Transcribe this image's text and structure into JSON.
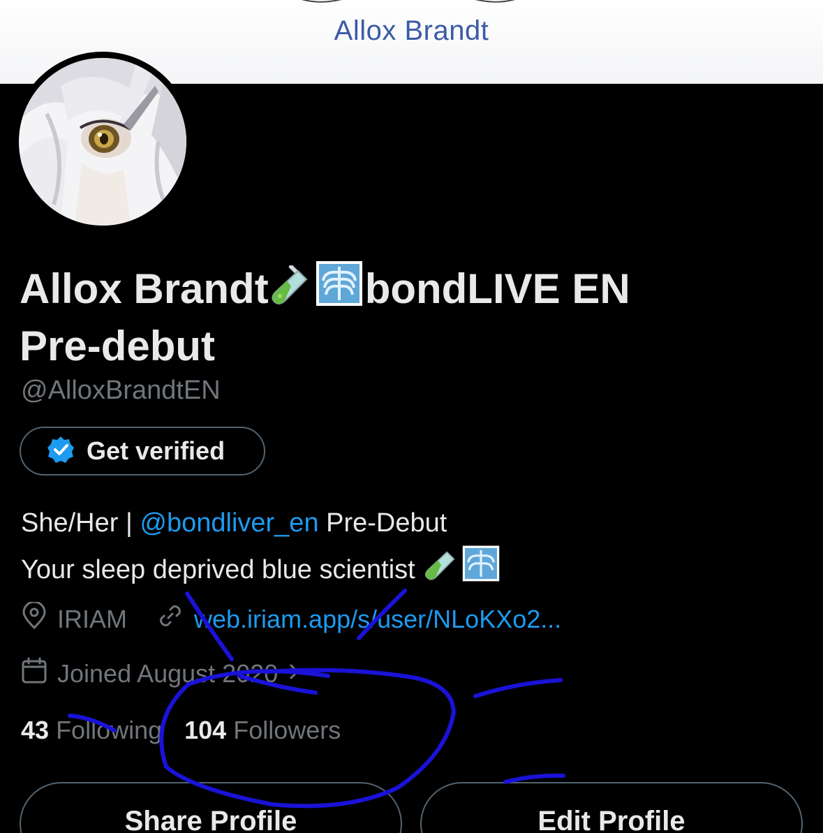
{
  "banner": {
    "title": "Allox Brandt"
  },
  "profile": {
    "name_line1": "Allox Brandt",
    "name_line1_suffix": "bondLIVE EN",
    "name_line2": "Pre-debut",
    "handle": "@AlloxBrandtEN",
    "get_verified_label": "Get verified",
    "bio": {
      "line1_prefix": "She/Her | ",
      "mention": "@bondliver_en",
      "line1_suffix": " Pre-Debut",
      "line2": "Your sleep deprived blue scientist "
    },
    "location": "IRIAM",
    "link": "web.iriam.app/s/user/NLoKXo2...",
    "joined": "Joined August 2020",
    "following_count": "43",
    "following_label": "Following",
    "followers_count": "104",
    "followers_label": "Followers"
  },
  "actions": {
    "share_label": "Share Profile",
    "edit_label": "Edit Profile"
  },
  "colors": {
    "background": "#000000",
    "accent_link": "#1d9bf0",
    "muted_text": "#71767b",
    "annotation_ink": "#1a12d6",
    "banner_text": "#3b5ba6"
  },
  "icons": [
    "test-tube-emoji",
    "xray-emoji",
    "verified-badge-icon",
    "location-pin-icon",
    "link-icon",
    "calendar-icon",
    "chevron-right-icon"
  ]
}
